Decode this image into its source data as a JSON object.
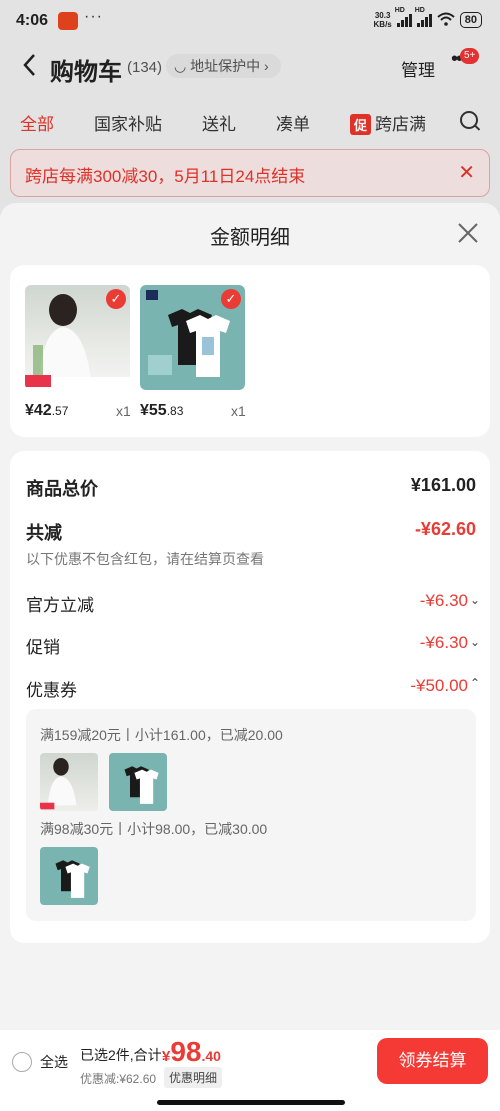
{
  "status_bar": {
    "time": "4:06",
    "dots": "···",
    "net_speed_value": "30.3",
    "net_speed_unit": "KB/s",
    "hd1": "HD",
    "hd2": "HD",
    "battery": "80"
  },
  "nav": {
    "title": "购物车",
    "count": "(134)",
    "address_chip": "地址保护中",
    "manage": "管理",
    "more_badge": "5+"
  },
  "tabs": [
    {
      "label": "全部"
    },
    {
      "label": "国家补贴"
    },
    {
      "label": "送礼"
    },
    {
      "label": "凑单"
    },
    {
      "label": "跨店满",
      "tag": "促"
    }
  ],
  "banner": {
    "text": "跨店每满300减30，5月11日24点结束"
  },
  "sheet": {
    "title": "金额明细",
    "items": [
      {
        "price_int": "¥42",
        "price_dec": ".57",
        "qty": "x1"
      },
      {
        "price_int": "¥55",
        "price_dec": ".83",
        "qty": "x1"
      }
    ],
    "summary": {
      "total_label": "商品总价",
      "total_value": "¥161.00",
      "reduction_label": "共减",
      "reduction_value": "-¥62.60",
      "reduction_hint": "以下优惠不包含红包，请在结算页查看",
      "official_label": "官方立减",
      "official_value": "-¥6.30",
      "promo_label": "促销",
      "promo_value": "-¥6.30",
      "coupon_label": "优惠券",
      "coupon_value": "-¥50.00"
    },
    "coupons": [
      {
        "text": "满159减20元丨小计161.00，已减20.00"
      },
      {
        "text": "满98减30元丨小计98.00，已减30.00"
      }
    ]
  },
  "bottom": {
    "select_all": "全选",
    "selected": "已选2件,合计:",
    "total_symbol": "¥",
    "total_int": "98",
    "total_dec": ".40",
    "discount": "优惠减:¥62.60",
    "detail": "优惠明细",
    "checkout": "领券结算"
  },
  "colors": {
    "accent": "#ea3b35",
    "background": "#f2f2f2"
  }
}
